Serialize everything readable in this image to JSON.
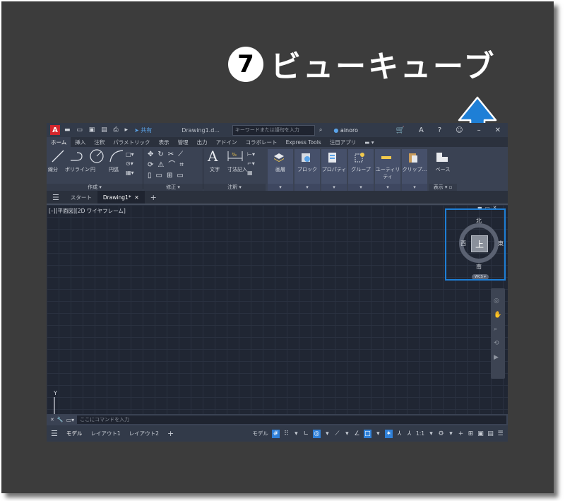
{
  "caption": {
    "number": "7",
    "text": "ビューキューブ"
  },
  "titlebar": {
    "app_logo": "A",
    "quick_access": "▬ ▭ ▣ ▤ ⎙ ▸",
    "share_label": "共有",
    "doc_title": "Drawing1.d...",
    "search_placeholder": "キーワードまたは語句を入力",
    "user": "ainoro",
    "minimize": "–",
    "close": "✕",
    "help": "?",
    "cart": "🛒",
    "learn": "A",
    "chat": "☺"
  },
  "ribbon_tabs": [
    "ホーム",
    "挿入",
    "注釈",
    "パラメトリック",
    "表示",
    "管理",
    "出力",
    "アドイン",
    "コラボレート",
    "Express Tools",
    "注目アプリ",
    "▬ ▾"
  ],
  "ribbon": {
    "draw": {
      "line": "線分",
      "polyline": "ポリライン",
      "circle": "円",
      "arc": "円弧",
      "footer": "作成 ▾"
    },
    "modify": {
      "footer": "修正 ▾"
    },
    "annotation": {
      "text": "文字",
      "dimension": "寸法記入",
      "footer": "注釈 ▾"
    },
    "layers": {
      "label": "画層",
      "footer": "▾"
    },
    "block": {
      "label": "ブロック",
      "footer": "▾"
    },
    "properties": {
      "label": "プロパティ",
      "footer": "▾"
    },
    "groups": {
      "label": "グループ",
      "footer": "▾"
    },
    "utilities": {
      "label": "ユーティリティ",
      "footer": "▾"
    },
    "clipboard": {
      "label": "クリップ...",
      "footer": "▾"
    },
    "view": {
      "base": "ベース",
      "footer": "表示 ▾ ▫"
    }
  },
  "doc_tabs": {
    "menu": "☰",
    "start": "スタート",
    "drawing": "Drawing1*",
    "close": "✕",
    "add": "+"
  },
  "viewport": {
    "label": "[–][平面図][2D ワイヤフレーム]"
  },
  "viewcube": {
    "north": "北",
    "south": "南",
    "east": "東",
    "west": "西",
    "face": "上",
    "wcs": "WCS ▾",
    "controls": "▬ ▭ ✕"
  },
  "ucs": {
    "y_label": "Y"
  },
  "command": {
    "placeholder": "ここにコマンドを入力",
    "close": "✕",
    "wrench": "🔧"
  },
  "status": {
    "tabs": [
      "モデル",
      "レイアウト1",
      "レイアウト2"
    ],
    "add": "+",
    "model_label": "モデル",
    "scale": "1:1",
    "icons": [
      "#",
      "⠿",
      "▾",
      "∟",
      "◎",
      "▾",
      "⟋",
      "▾",
      "∠",
      "□",
      "▾",
      "✶",
      "⅄",
      "⅄",
      "▾",
      "⚙",
      "▾",
      "+",
      "⊞",
      "▣",
      "▤",
      "☰"
    ]
  }
}
